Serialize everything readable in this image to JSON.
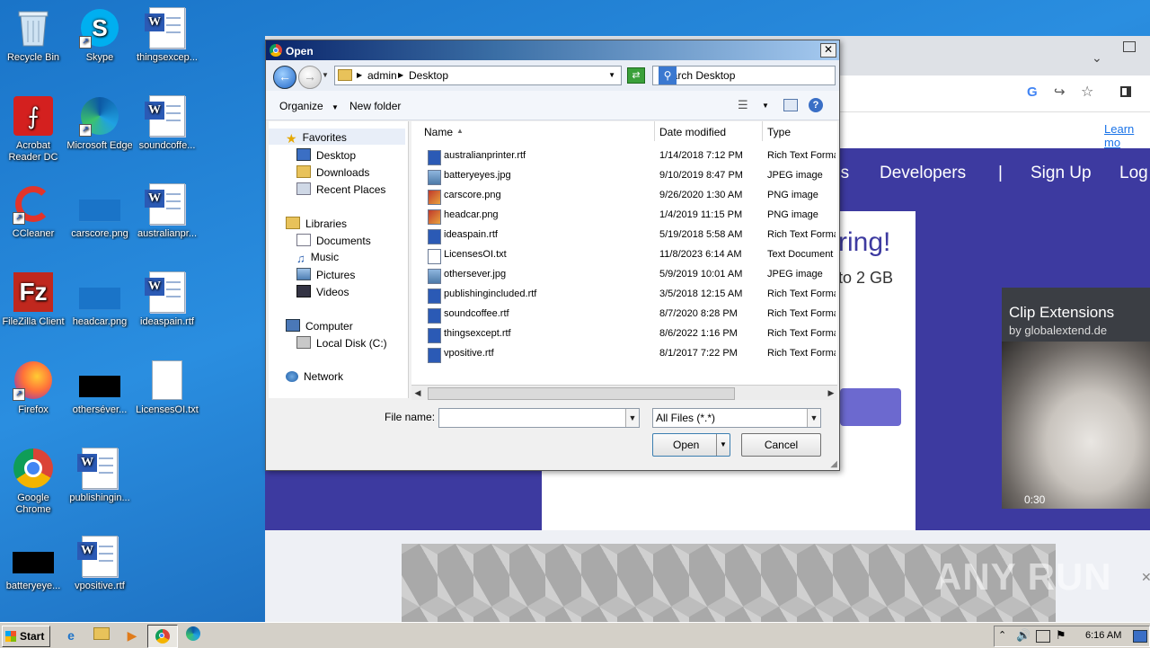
{
  "desktop": {
    "icons": [
      {
        "label": "Recycle Bin"
      },
      {
        "label": "Skype"
      },
      {
        "label": "thingsexcep..."
      },
      {
        "label": "Acrobat Reader DC"
      },
      {
        "label": "Microsoft Edge"
      },
      {
        "label": "soundcoffe..."
      },
      {
        "label": "CCleaner"
      },
      {
        "label": "carscore.png"
      },
      {
        "label": "australianpr..."
      },
      {
        "label": "FileZilla Client"
      },
      {
        "label": "headcar.png"
      },
      {
        "label": "ideaspain.rtf"
      },
      {
        "label": "Firefox"
      },
      {
        "label": "otherséver..."
      },
      {
        "label": "LicensesOI.txt"
      },
      {
        "label": "Google Chrome"
      },
      {
        "label": "publishingin..."
      },
      {
        "label": "batteryeye..."
      },
      {
        "label": "vpositive.rtf"
      }
    ]
  },
  "browser": {
    "nav": [
      "ns",
      "Developers",
      "|",
      "Sign Up",
      "Log"
    ],
    "learn_more": "Learn mo",
    "hero_heading": "ring!",
    "hero_sub": "to 2 GB",
    "video_title": "Clip Extensions",
    "video_sub": "by globalextend.de",
    "video_time": "0:30",
    "watermark": "ANY RUN"
  },
  "dialog": {
    "title": "Open",
    "address": {
      "crumb1": "admin",
      "crumb2": "Desktop"
    },
    "search_placeholder": "Search Desktop",
    "organize": "Organize",
    "new_folder": "New folder",
    "nav_tree": {
      "favorites": "Favorites",
      "desktop": "Desktop",
      "downloads": "Downloads",
      "recent": "Recent Places",
      "libraries": "Libraries",
      "documents": "Documents",
      "music": "Music",
      "pictures": "Pictures",
      "videos": "Videos",
      "computer": "Computer",
      "local_disk": "Local Disk (C:)",
      "network": "Network"
    },
    "columns": {
      "name": "Name",
      "date": "Date modified",
      "type": "Type"
    },
    "files": [
      {
        "name": "australianprinter.rtf",
        "date": "1/14/2018 7:12 PM",
        "type": "Rich Text Forma",
        "kind": "rtf"
      },
      {
        "name": "batteryeyes.jpg",
        "date": "9/10/2019 8:47 PM",
        "type": "JPEG image",
        "kind": "img"
      },
      {
        "name": "carscore.png",
        "date": "9/26/2020 1:30 AM",
        "type": "PNG image",
        "kind": "png"
      },
      {
        "name": "headcar.png",
        "date": "1/4/2019 11:15 PM",
        "type": "PNG image",
        "kind": "png"
      },
      {
        "name": "ideaspain.rtf",
        "date": "5/19/2018 5:58 AM",
        "type": "Rich Text Forma",
        "kind": "rtf"
      },
      {
        "name": "LicensesOI.txt",
        "date": "11/8/2023 6:14 AM",
        "type": "Text Document",
        "kind": "txt"
      },
      {
        "name": "othersever.jpg",
        "date": "5/9/2019 10:01 AM",
        "type": "JPEG image",
        "kind": "img"
      },
      {
        "name": "publishingincluded.rtf",
        "date": "3/5/2018 12:15 AM",
        "type": "Rich Text Forma",
        "kind": "rtf"
      },
      {
        "name": "soundcoffee.rtf",
        "date": "8/7/2020 8:28 PM",
        "type": "Rich Text Forma",
        "kind": "rtf"
      },
      {
        "name": "thingsexcept.rtf",
        "date": "8/6/2022 1:16 PM",
        "type": "Rich Text Forma",
        "kind": "rtf"
      },
      {
        "name": "vpositive.rtf",
        "date": "8/1/2017 7:22 PM",
        "type": "Rich Text Forma",
        "kind": "rtf"
      }
    ],
    "file_name_label": "File name:",
    "file_name_value": "",
    "filter": "All Files (*.*)",
    "open": "Open",
    "cancel": "Cancel"
  },
  "taskbar": {
    "start": "Start",
    "clock": "6:16 AM"
  }
}
